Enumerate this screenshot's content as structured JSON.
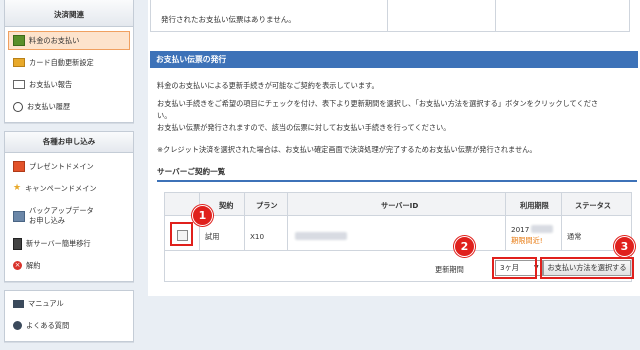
{
  "sidebar": {
    "payment": {
      "title": "決済関連",
      "items": [
        {
          "label": "料金のお支払い",
          "active": true
        },
        {
          "label": "カード自動更新設定"
        },
        {
          "label": "お支払い報告"
        },
        {
          "label": "お支払い履歴"
        }
      ]
    },
    "applications": {
      "title": "各種お申し込み",
      "items": [
        {
          "label": "プレゼントドメイン"
        },
        {
          "label": "キャンペーンドメイン"
        },
        {
          "label": "バックアップデータ"
        },
        {
          "label": "お申し込み"
        },
        {
          "label": "新サーバー簡単移行"
        },
        {
          "label": "解約"
        }
      ]
    },
    "help": {
      "items": [
        {
          "label": "マニュアル"
        },
        {
          "label": "よくある質問"
        }
      ]
    }
  },
  "main": {
    "top_message": "発行されたお支払い伝票はありません。",
    "section_title": "お支払い伝票の発行",
    "desc1": "料金のお支払いによる更新手続きが可能なご契約を表示しています。",
    "desc2": "お支払い手続きをご希望の項目にチェックを付け、表下より更新期間を選択し、「お支払い方法を選択する」ボタンをクリックしてくださ",
    "desc3": "い。",
    "desc4": "お支払い伝票が発行されますので、該当の伝票に対してお支払い手続きを行ってください。",
    "desc5": "※クレジット決済を選択された場合は、お支払い確定画面で決済処理が完了するためお支払い伝票が発行されません。",
    "contracts_heading": "サーバーご契約一覧",
    "table": {
      "headers": [
        "契約",
        "プラン",
        "サーバーID",
        "利用期限",
        "ステータス"
      ],
      "row": {
        "contract": "試用",
        "plan": "X10",
        "expiry_year": "2017",
        "expiry_note": "期限間近!",
        "status": "通常"
      }
    },
    "period_label": "更新期間",
    "period_value": "3ヶ月",
    "select_arrow": "▼",
    "choose_button": "お支払い方法を選択する",
    "badges": [
      "1",
      "2",
      "3"
    ]
  },
  "colors": {
    "accent_blue": "#3d72b8",
    "highlight_red": "#e0201c",
    "active_bg": "#fde3cc",
    "warning_orange": "#e87a10"
  }
}
